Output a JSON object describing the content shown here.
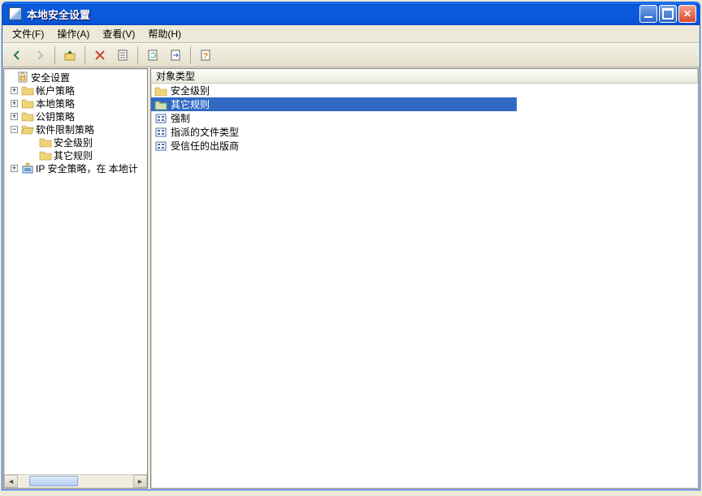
{
  "window": {
    "title": "本地安全设置"
  },
  "menu": {
    "file": "文件(F)",
    "action": "操作(A)",
    "view": "查看(V)",
    "help": "帮助(H)"
  },
  "tree": {
    "root": "安全设置",
    "items": [
      {
        "label": "帐户策略",
        "expanded": false
      },
      {
        "label": "本地策略",
        "expanded": false
      },
      {
        "label": "公钥策略",
        "expanded": false
      },
      {
        "label": "软件限制策略",
        "expanded": true,
        "children": [
          {
            "label": "安全级别"
          },
          {
            "label": "其它规则"
          }
        ]
      },
      {
        "label": "IP 安全策略，在 本地计",
        "expanded": false,
        "icon": "ipsec"
      }
    ]
  },
  "list": {
    "header": "对象类型",
    "rows": [
      {
        "label": "安全级别",
        "icon": "folder",
        "selected": false
      },
      {
        "label": "其它规则",
        "icon": "folder",
        "selected": true
      },
      {
        "label": "强制",
        "icon": "policy",
        "selected": false
      },
      {
        "label": "指派的文件类型",
        "icon": "policy",
        "selected": false
      },
      {
        "label": "受信任的出版商",
        "icon": "policy",
        "selected": false
      }
    ]
  }
}
